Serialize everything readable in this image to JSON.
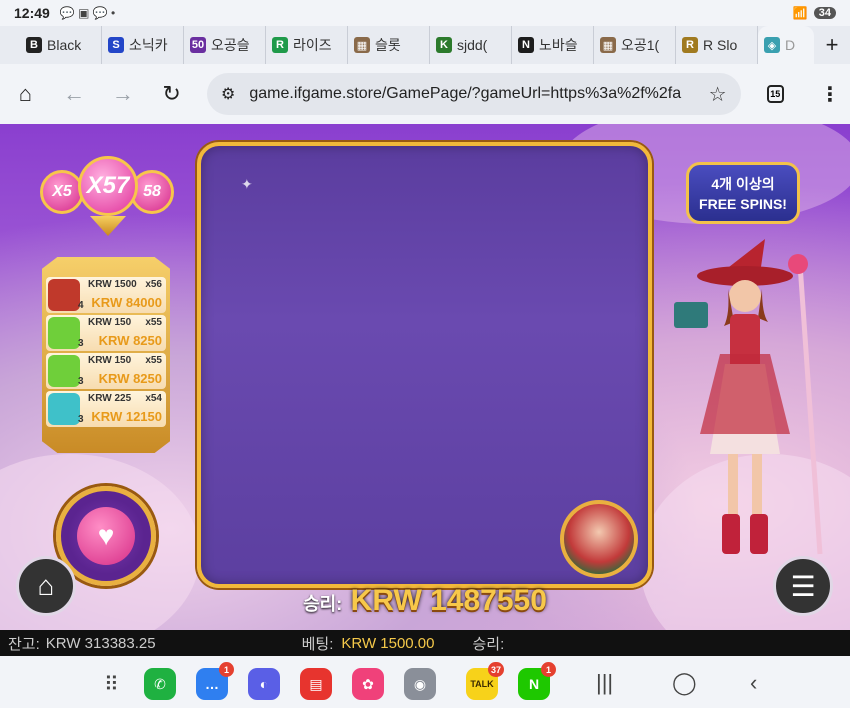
{
  "status": {
    "time": "12:49",
    "notif_icons": "💬 ▣ 💬 •",
    "signal": "📶",
    "battery": "34"
  },
  "tabs": [
    {
      "label": "Black",
      "fav_text": "B",
      "fav_color": "#222222"
    },
    {
      "label": "소닉카",
      "fav_text": "S",
      "fav_color": "#2346c8"
    },
    {
      "label": "오공슬",
      "fav_text": "50",
      "fav_color": "#6a2fa0"
    },
    {
      "label": "라이즈",
      "fav_text": "R",
      "fav_color": "#1f9a4a"
    },
    {
      "label": "슬롯",
      "fav_text": "▦",
      "fav_color": "#8a6a4a"
    },
    {
      "label": "sjdd(",
      "fav_text": "K",
      "fav_color": "#2c7a2c"
    },
    {
      "label": "노바슬",
      "fav_text": "N",
      "fav_color": "#1d1d1d"
    },
    {
      "label": "오공1(",
      "fav_text": "▦",
      "fav_color": "#8a6a4a"
    },
    {
      "label": "R Slo",
      "fav_text": "R",
      "fav_color": "#a07a20"
    },
    {
      "label": "D",
      "fav_text": "◈",
      "fav_color": "#3aa0b0"
    }
  ],
  "toolbar": {
    "url": "game.ifgame.store/GamePage/?gameUrl=https%3a%2f%2fa",
    "tab_count": "15"
  },
  "game": {
    "multipliers": {
      "left": "X5",
      "main": "X57",
      "right": "58"
    },
    "paytable": [
      {
        "bet": "KRW 1500",
        "mult": "x56",
        "count": "4",
        "win": "KRW 84000",
        "sym_color": "#c0392b"
      },
      {
        "bet": "KRW 150",
        "mult": "x55",
        "count": "3",
        "win": "KRW 8250",
        "sym_color": "#6fcf3a"
      },
      {
        "bet": "KRW 150",
        "mult": "x55",
        "count": "3",
        "win": "KRW 8250",
        "sym_color": "#6fcf3a"
      },
      {
        "bet": "KRW 225",
        "mult": "x54",
        "count": "3",
        "win": "KRW 12150",
        "sym_color": "#3fc1c9"
      }
    ],
    "free_spins_line1": "4개 이상의",
    "free_spins_line2": "FREE SPINS!",
    "win_label": "승리:",
    "win_value": "KRW 1487550"
  },
  "info_bar": {
    "balance_label": "잔고:",
    "balance_value": "KRW 313383.25",
    "bet_label": "베팅:",
    "bet_value": "KRW 1500.00",
    "win_label": "승리:"
  },
  "dock": {
    "apps": [
      {
        "name": "phone",
        "color": "#1fb141",
        "glyph": "✆",
        "badge": ""
      },
      {
        "name": "messages",
        "color": "#2f7ff0",
        "glyph": "…",
        "badge": "1"
      },
      {
        "name": "internet",
        "color": "#5a5fe6",
        "glyph": "◐",
        "badge": ""
      },
      {
        "name": "notes",
        "color": "#e7342e",
        "glyph": "▤",
        "badge": ""
      },
      {
        "name": "gallery",
        "color": "#f0417a",
        "glyph": "✿",
        "badge": ""
      },
      {
        "name": "camera",
        "color": "#8a8f99",
        "glyph": "◉",
        "badge": ""
      },
      {
        "name": "kakaotalk",
        "color": "#f7d21a",
        "glyph": "TALK",
        "badge": "37"
      },
      {
        "name": "naver",
        "color": "#1ec800",
        "glyph": "N",
        "badge": "1"
      }
    ]
  }
}
